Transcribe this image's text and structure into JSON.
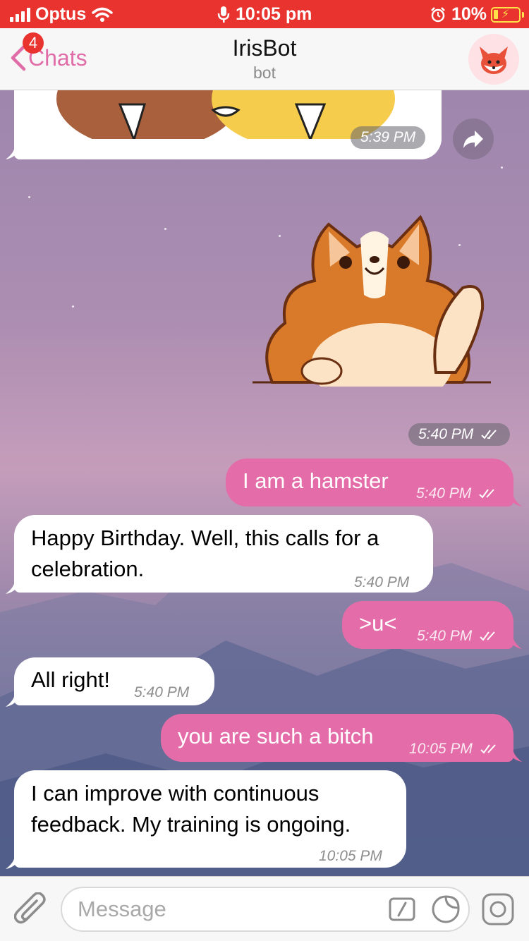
{
  "status_bar": {
    "carrier": "Optus",
    "time": "10:05 pm",
    "battery": "10%",
    "signal_icon": "signal-bars-icon",
    "wifi_icon": "wifi-icon",
    "mic_icon": "microphone-icon",
    "alarm_icon": "alarm-clock-icon",
    "battery_icon": "battery-charging-icon",
    "bar_color": "#e8332f"
  },
  "nav": {
    "back_label": "Chats",
    "unread_count": "4",
    "title": "IrisBot",
    "subtitle": "bot",
    "avatar_icon": "fox-avatar-icon",
    "accent": "#e06ca8"
  },
  "chat": {
    "top_sticker_time": "5:39 PM",
    "forward_icon": "forward-arrow-icon",
    "sticker_time": "5:40 PM",
    "messages": [
      {
        "direction": "out",
        "text": "I am a hamster",
        "time": "5:40 PM"
      },
      {
        "direction": "in",
        "text": "Happy Birthday. Well, this calls for a celebration.",
        "time": "5:40 PM"
      },
      {
        "direction": "out",
        "text": ">u<",
        "time": "5:40 PM"
      },
      {
        "direction": "in",
        "text": "All right!",
        "time": "5:40 PM"
      },
      {
        "direction": "out",
        "text": "you are such a bitch",
        "time": "10:05 PM"
      },
      {
        "direction": "in",
        "text": "I can improve with continuous feedback. My training is ongoing.",
        "time": "10:05 PM"
      }
    ],
    "outgoing_color": "#e46ca8",
    "incoming_color": "#ffffff"
  },
  "input_bar": {
    "placeholder": "Message",
    "attach_icon": "paperclip-icon",
    "command_icon": "slash-command-icon",
    "sticker_icon": "sticker-icon",
    "camera_icon": "camera-icon"
  }
}
